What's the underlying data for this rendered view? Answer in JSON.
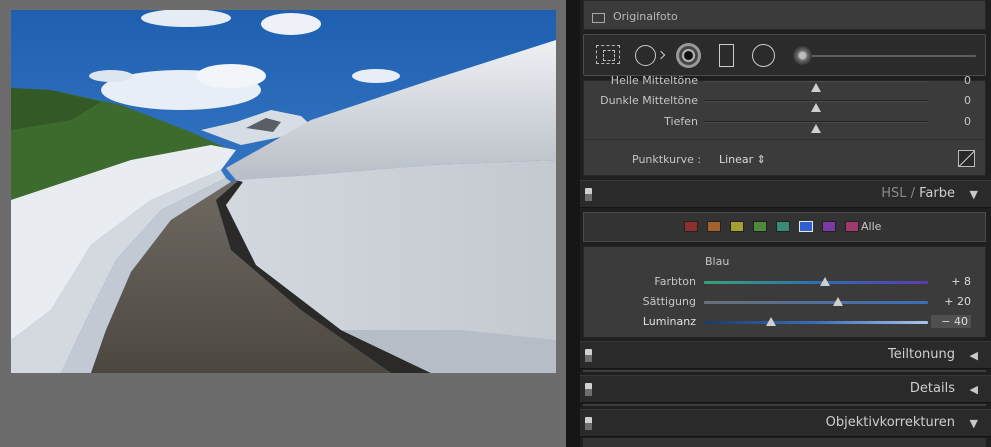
{
  "before_after": {
    "label": "Originalfoto"
  },
  "tone": {
    "sliders": [
      {
        "label": "Helle Mitteltöne",
        "value": "0",
        "level": 0.5
      },
      {
        "label": "Dunkle Mitteltöne",
        "value": "0",
        "level": 0.5
      },
      {
        "label": "Tiefen",
        "value": "0",
        "level": 0.5
      }
    ],
    "curve_label": "Punktkurve :",
    "curve_value": "Linear ⇕"
  },
  "panels": {
    "hsl": {
      "title_hsl": "HSL",
      "title_sep": " / ",
      "title_farbe": "Farbe",
      "arrow": "▼"
    },
    "split_toning": {
      "title": "Teiltonung",
      "arrow": "◀"
    },
    "details": {
      "title": "Details",
      "arrow": "◀"
    },
    "lens": {
      "title": "Objektivkorrekturen",
      "arrow": "▼"
    }
  },
  "hsl": {
    "swatches": [
      "#8c2f2f",
      "#a4612e",
      "#a4a032",
      "#4d8a39",
      "#3a8a76",
      "#3060cf",
      "#7a3ca4",
      "#a03a6a"
    ],
    "selected_swatch": 5,
    "all_label": "Alle",
    "color_name": "Blau",
    "sliders": [
      {
        "label": "Farbton",
        "value": "+ 8",
        "level": 0.54
      },
      {
        "label": "Sättigung",
        "value": "+ 20",
        "level": 0.6
      },
      {
        "label": "Luminanz",
        "value": "− 40",
        "level": 0.3
      }
    ]
  },
  "colors": {
    "panel_bg": "#3b3b3b",
    "header_bg": "#2a2a2a",
    "canvas_bg": "#6c6c6c"
  }
}
